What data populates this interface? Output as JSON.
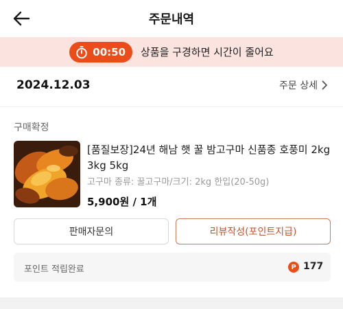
{
  "header": {
    "title": "주문내역",
    "back_icon": "arrow-left-icon"
  },
  "timer_banner": {
    "timer": "00:50",
    "message": "상품을 구경하면 시간이 줄어요",
    "accent_color": "#ea4c1a",
    "background_color": "#fbe3df"
  },
  "order": {
    "date": "2024.12.03",
    "detail_link": "주문 상세",
    "status": "구매확정",
    "product": {
      "name": "[품질보장]24년 해남 햇 꿀 밤고구마 신품종 호풍미 2kg 3kg 5kg",
      "option": "고구마 종류: 꿀고구마/크기: 2kg 한입(20-50g)",
      "price": "5,900원 / 1개"
    },
    "buttons": {
      "inquiry": "판매자문의",
      "review": "리뷰작성(포인트지급)"
    },
    "points": {
      "label": "포인트 적립완료",
      "icon_letter": "P",
      "value": "177"
    }
  }
}
